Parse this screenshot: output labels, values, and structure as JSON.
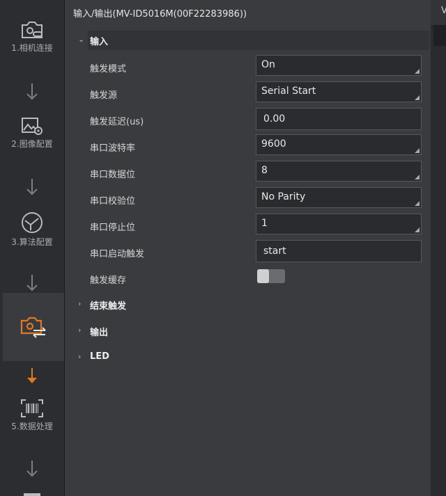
{
  "nav": {
    "steps": [
      {
        "label": "1.相机连接",
        "icon": "camera-link-icon"
      },
      {
        "label": "2.图像配置",
        "icon": "image-gear-icon"
      },
      {
        "label": "3.算法配置",
        "icon": "algorithm-icon"
      },
      {
        "label": "",
        "icon": "camera-transfer-icon",
        "active": true
      },
      {
        "label": "5.数据处理",
        "icon": "barcode-scan-icon"
      }
    ],
    "accent": "#e07a22"
  },
  "panel": {
    "title": "输入/输出(MV-ID5016M(00F22283986))",
    "input_section": {
      "label": "输入",
      "rows": [
        {
          "label": "触发模式",
          "value": "On",
          "type": "select"
        },
        {
          "label": "触发源",
          "value": "Serial Start",
          "type": "select"
        },
        {
          "label": "触发延迟(us)",
          "value": "0.00",
          "type": "input"
        },
        {
          "label": "串口波特率",
          "value": "9600",
          "type": "select"
        },
        {
          "label": "串口数据位",
          "value": "8",
          "type": "select"
        },
        {
          "label": "串口校验位",
          "value": "No Parity",
          "type": "select"
        },
        {
          "label": "串口停止位",
          "value": "1",
          "type": "select"
        },
        {
          "label": "串口启动触发",
          "value": "start",
          "type": "input"
        },
        {
          "label": "触发缓存",
          "value": "off",
          "type": "toggle"
        }
      ]
    },
    "sections": [
      {
        "label": "结束触发"
      },
      {
        "label": "输出"
      },
      {
        "label": "LED"
      }
    ]
  },
  "right_strip": {
    "char": "V"
  }
}
